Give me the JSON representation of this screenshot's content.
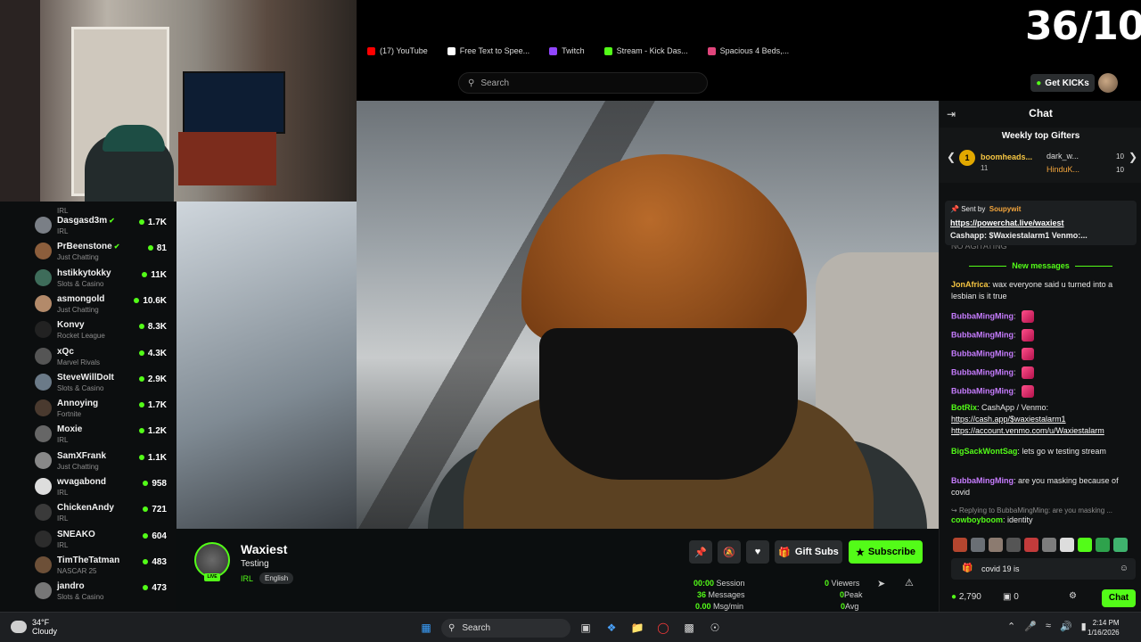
{
  "overlay_counter": "36/10",
  "bookmarks": [
    {
      "label": "(17) YouTube",
      "icon": "youtube-icon",
      "color": "#ff0000"
    },
    {
      "label": "Free Text to Spee...",
      "icon": "doc-icon",
      "color": "#ffffff"
    },
    {
      "label": "Twitch",
      "icon": "twitch-icon",
      "color": "#9146ff"
    },
    {
      "label": "Stream - Kick Das...",
      "icon": "kick-icon",
      "color": "#53fc18"
    },
    {
      "label": "Spacious 4 Beds,...",
      "icon": "home-icon",
      "color": "#e0457b"
    }
  ],
  "search": {
    "placeholder": "Search"
  },
  "header": {
    "get_kicks": "Get KICKs"
  },
  "sidebar": {
    "partial_top_cat": "IRL",
    "items": [
      {
        "name": "Dasgasd3m",
        "verified": true,
        "category": "IRL",
        "viewers": "1.7K"
      },
      {
        "name": "PrBeenstone",
        "verified": true,
        "category": "Just Chatting",
        "viewers": "81"
      },
      {
        "name": "hstikkytokky",
        "verified": false,
        "category": "Slots & Casino",
        "viewers": "11K"
      },
      {
        "name": "asmongold",
        "verified": false,
        "category": "Just Chatting",
        "viewers": "10.6K"
      },
      {
        "name": "Konvy",
        "verified": false,
        "category": "Rocket League",
        "viewers": "8.3K"
      },
      {
        "name": "xQc",
        "verified": false,
        "category": "Marvel Rivals",
        "viewers": "4.3K"
      },
      {
        "name": "SteveWillDoIt",
        "verified": false,
        "category": "Slots & Casino",
        "viewers": "2.9K"
      },
      {
        "name": "Annoying",
        "verified": false,
        "category": "Fortnite",
        "viewers": "1.7K"
      },
      {
        "name": "Moxie",
        "verified": false,
        "category": "IRL",
        "viewers": "1.2K"
      },
      {
        "name": "SamXFrank",
        "verified": false,
        "category": "Just Chatting",
        "viewers": "1.1K"
      },
      {
        "name": "wvagabond",
        "verified": false,
        "category": "IRL",
        "viewers": "958"
      },
      {
        "name": "ChickenAndy",
        "verified": false,
        "category": "IRL",
        "viewers": "721"
      },
      {
        "name": "SNEAKO",
        "verified": false,
        "category": "IRL",
        "viewers": "604"
      },
      {
        "name": "TimTheTatman",
        "verified": false,
        "category": "NASCAR 25",
        "viewers": "483"
      },
      {
        "name": "jandro",
        "verified": false,
        "category": "Slots & Casino",
        "viewers": "473"
      }
    ]
  },
  "stream": {
    "name": "Waxiest",
    "title": "Testing",
    "category": "IRL",
    "language": "English",
    "gift_subs": "Gift Subs",
    "subscribe": "Subscribe",
    "stats": {
      "session": "00:00",
      "session_label": "Session",
      "messages": "36",
      "messages_label": "Messages",
      "msg_min": "0.00",
      "msg_min_label": "Msg/min",
      "viewers": "0",
      "viewers_label": "Viewers",
      "peak": "0",
      "peak_label": "Peak",
      "avg": "0",
      "avg_label": "Avg"
    }
  },
  "chat": {
    "title": "Chat",
    "gifters_title": "Weekly top Gifters",
    "gifter1": {
      "rank": "1",
      "name": "boomheads...",
      "count": "11"
    },
    "gifter2": {
      "name": "dark_w...",
      "count": "10"
    },
    "gifter3": {
      "name": "HinduK...",
      "count": "10"
    },
    "pinned": {
      "sent_by": "Sent by",
      "user": "Soupywit",
      "link": "https://powerchat.live/waxiest",
      "text": "Cashapp: $Waxiestalarm1 Venmo:..."
    },
    "partial_top": "NO AGITATING",
    "new_messages": "New messages",
    "messages": [
      {
        "user": "JonAfrica",
        "color": "#f5c542",
        "text": "wax everyone said u turned into a lesbian is it true"
      },
      {
        "user": "BubbaMingMing",
        "color": "#c77dff",
        "text": ""
      },
      {
        "user": "BubbaMingMing",
        "color": "#c77dff",
        "text": ""
      },
      {
        "user": "BubbaMingMing",
        "color": "#c77dff",
        "text": ""
      },
      {
        "user": "BubbaMingMing",
        "color": "#c77dff",
        "text": ""
      },
      {
        "user": "BubbaMingMing",
        "color": "#c77dff",
        "text": ""
      },
      {
        "user": "BotRix",
        "color": "#53fc18",
        "text": "CashApp / Venmo:",
        "link1": "https://cash.app/$waxiestalarm1",
        "link2": "https://account.venmo.com/u/Waxiestalarm"
      },
      {
        "user": "BigSackWontSag",
        "color": "#53fc18",
        "text": "lets go w testing stream"
      },
      {
        "user": "BubbaMingMing",
        "color": "#c77dff",
        "text": "are you masking because of covid"
      }
    ],
    "reply_to": "Replying to BubbaMingMing: are you masking ...",
    "last_user": "cowboyboom",
    "last_text": "identity",
    "input_value": "covid 19 is",
    "kicks_balance": "2,790",
    "gift_count": "0",
    "send_label": "Chat"
  },
  "taskbar": {
    "temperature": "34°F",
    "condition": "Cloudy",
    "search": "Search",
    "time": "2:14 PM",
    "date": "1/16/2026"
  }
}
